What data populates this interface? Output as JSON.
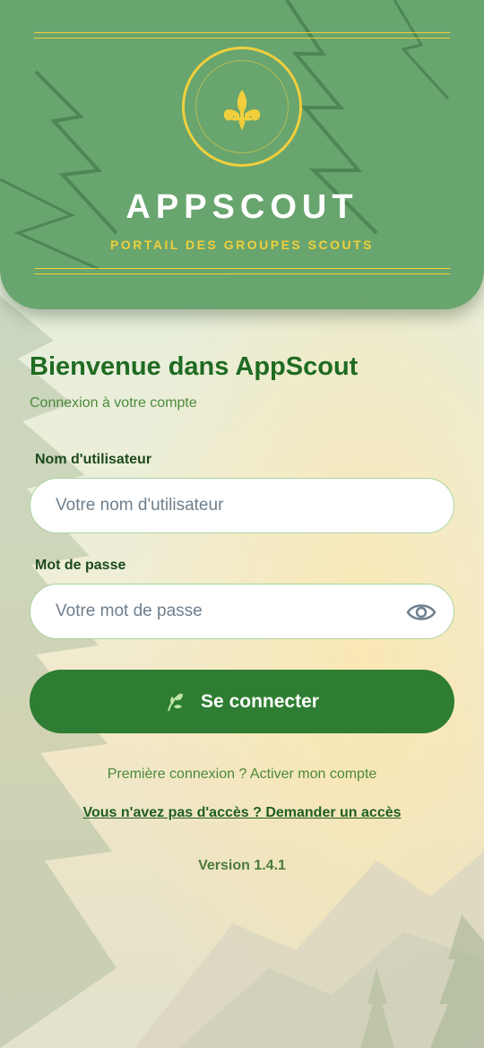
{
  "header": {
    "app_name": "APPSCOUT",
    "tagline": "PORTAIL DES GROUPES SCOUTS",
    "emblem_icon": "fleur-de-lis-icon"
  },
  "welcome": {
    "title": "Bienvenue dans AppScout",
    "subtitle": "Connexion à votre compte"
  },
  "form": {
    "username_label": "Nom d'utilisateur",
    "username_placeholder": "Votre nom d'utilisateur",
    "username_value": "",
    "password_label": "Mot de passe",
    "password_placeholder": "Votre mot de passe",
    "password_value": "",
    "password_toggle_icon": "eye-icon",
    "submit_label": "Se connecter",
    "submit_icon": "leaf-icon"
  },
  "links": {
    "first_login": "Première connexion ? Activer mon compte",
    "request_access": "Vous n'avez pas d'accès ? Demander un accès"
  },
  "footer": {
    "version": "Version 1.4.1"
  },
  "colors": {
    "header_green": "#569b60",
    "gold": "#f1cf3c",
    "primary_green": "#2e7d32",
    "title_green": "#1f6b22",
    "text_green": "#4b8a3a",
    "input_border": "#a9d39f"
  }
}
